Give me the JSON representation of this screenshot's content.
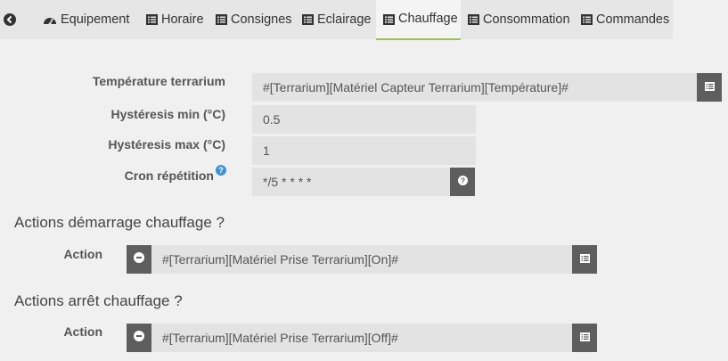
{
  "tabs": [
    {
      "label": "Equipement",
      "icon": "dashboard-icon"
    },
    {
      "label": "Horaire",
      "icon": "list-icon"
    },
    {
      "label": "Consignes",
      "icon": "list-icon"
    },
    {
      "label": "Eclairage",
      "icon": "list-icon"
    },
    {
      "label": "Chauffage",
      "icon": "list-icon",
      "active": true
    },
    {
      "label": "Consommation",
      "icon": "list-icon"
    },
    {
      "label": "Commandes",
      "icon": "list-icon"
    }
  ],
  "form": {
    "temperature_label": "Température terrarium",
    "temperature_value": "#[Terrarium][Matériel Capteur Terrarium][Température]#",
    "hyst_min_label": "Hystéresis min (°C)",
    "hyst_min_value": "0.5",
    "hyst_max_label": "Hystéresis max (°C)",
    "hyst_max_value": "1",
    "cron_label": "Cron répétition",
    "cron_value": "*/5 * * * *"
  },
  "start_section": {
    "title": "Actions démarrage chauffage ?",
    "action_label": "Action",
    "action_value": "#[Terrarium][Matériel Prise Terrarium][On]#"
  },
  "stop_section": {
    "title": "Actions arrêt chauffage ?",
    "action_label": "Action",
    "action_value": "#[Terrarium][Matériel Prise Terrarium][Off]#"
  },
  "colors": {
    "active_tab_underline": "#9ac34b",
    "dark_button": "#5e5e5e",
    "help_icon": "#3a93d6"
  }
}
